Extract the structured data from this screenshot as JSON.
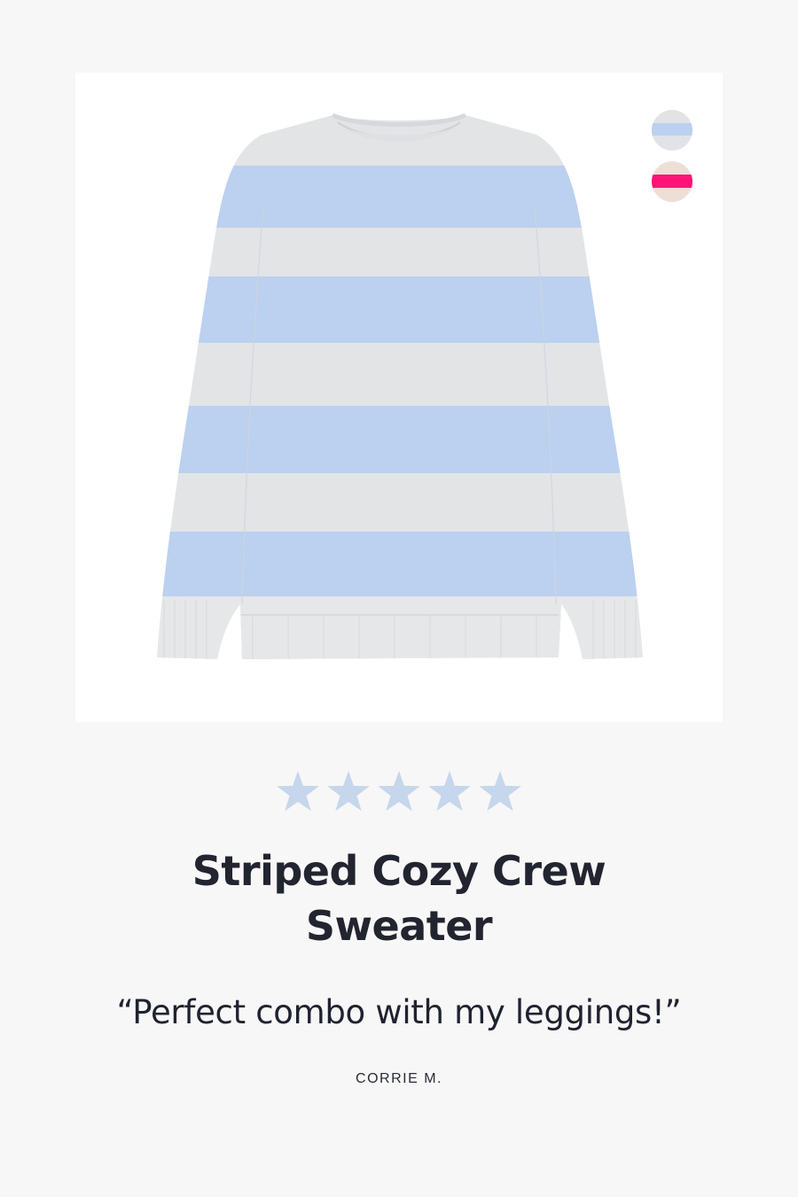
{
  "product": {
    "name": "Striped Cozy Crew Sweater",
    "image_icon": "striped-sweater-icon",
    "colors": {
      "stripe_blue": "#b8cfee",
      "heather_grey": "#e3e4e6"
    },
    "swatches": [
      {
        "name": "blue-grey-stripe",
        "colors": [
          "#e2e3e6",
          "#bcd0ef"
        ]
      },
      {
        "name": "pink-oat-stripe",
        "colors": [
          "#eedfd6",
          "#ff1477"
        ]
      }
    ]
  },
  "review": {
    "rating": 5,
    "rating_max": 5,
    "star_color": "#c6d6ec",
    "quote": "“Perfect combo with my leggings!”",
    "author": "CORRIE M."
  }
}
